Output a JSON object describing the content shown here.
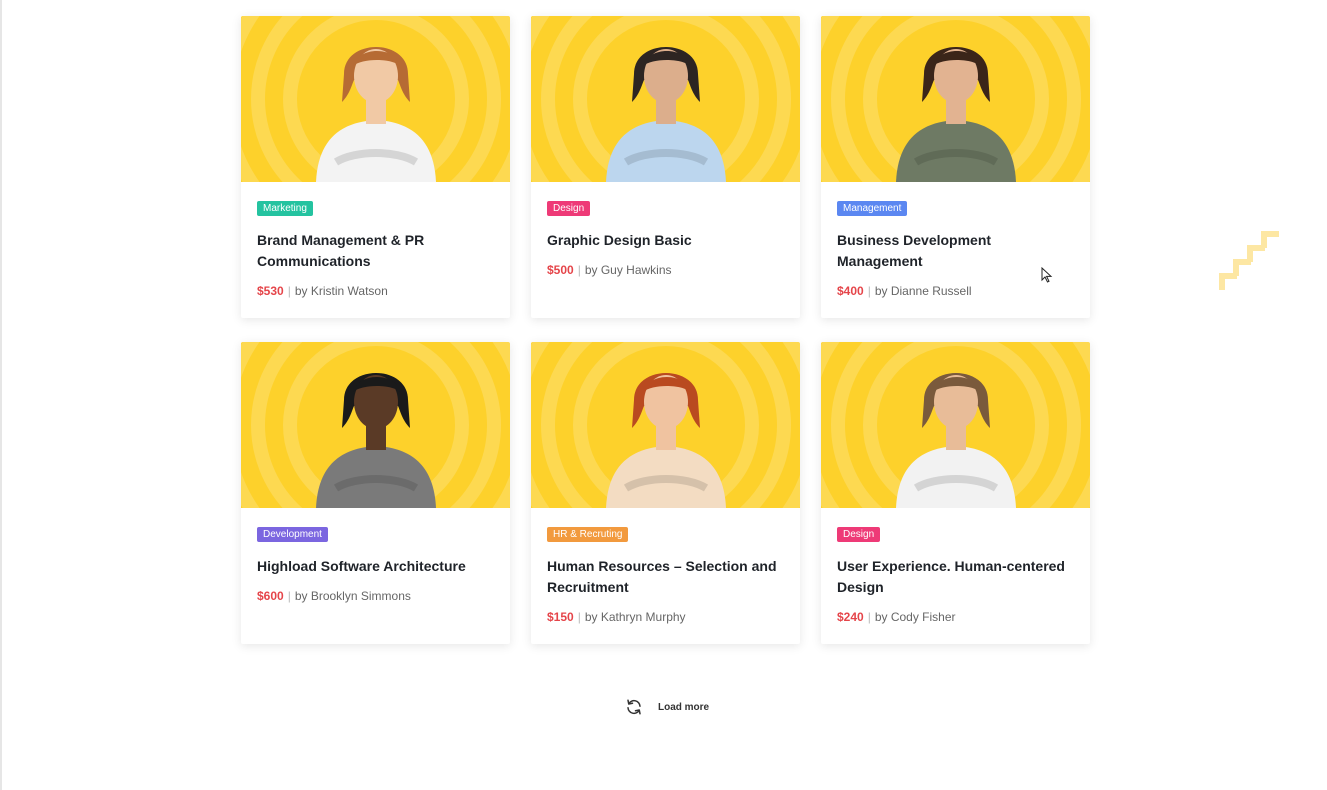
{
  "courses": [
    {
      "category": "Marketing",
      "category_color": "#24c3a0",
      "title": "Brand Management & PR Communications",
      "price": "$530",
      "author": "by Kristin Watson",
      "portrait": {
        "skin": "#f1c9a5",
        "hair": "#b66b34",
        "shirt": "#f3f3f3"
      }
    },
    {
      "category": "Design",
      "category_color": "#ee3a77",
      "title": "Graphic Design Basic",
      "price": "$500",
      "author": "by Guy Hawkins",
      "portrait": {
        "skin": "#dcae8c",
        "hair": "#2d2522",
        "shirt": "#bcd6ee"
      }
    },
    {
      "category": "Management",
      "category_color": "#5b87f1",
      "title": "Business Development Management",
      "price": "$400",
      "author": "by Dianne Russell",
      "portrait": {
        "skin": "#e2b391",
        "hair": "#3b2519",
        "shirt": "#6e7a64"
      }
    },
    {
      "category": "Development",
      "category_color": "#7b66e0",
      "title": "Highload Software Architecture",
      "price": "$600",
      "author": "by Brooklyn Simmons",
      "portrait": {
        "skin": "#5a3a26",
        "hair": "#1a1a1a",
        "shirt": "#7a7a7a"
      }
    },
    {
      "category": "HR & Recruting",
      "category_color": "#f29a3e",
      "title": "Human Resources – Selection and Recruitment",
      "price": "$150",
      "author": "by Kathryn Murphy",
      "portrait": {
        "skin": "#f0c3a0",
        "hair": "#b94a20",
        "shirt": "#f3dcc2"
      }
    },
    {
      "category": "Design",
      "category_color": "#ee3a77",
      "title": "User Experience. Human-centered Design",
      "price": "$240",
      "author": "by Cody Fisher",
      "portrait": {
        "skin": "#e8bc98",
        "hair": "#7a5a3c",
        "shirt": "#f2f2f2"
      }
    }
  ],
  "load_more": {
    "label": "Load more",
    "icon": "refresh-icon"
  },
  "scroll_top": {
    "icon": "scroll-to-top-icon",
    "color": "#fde7a3"
  },
  "thumbnail_bg": "#fdd12b",
  "price_color": "#e5454a"
}
